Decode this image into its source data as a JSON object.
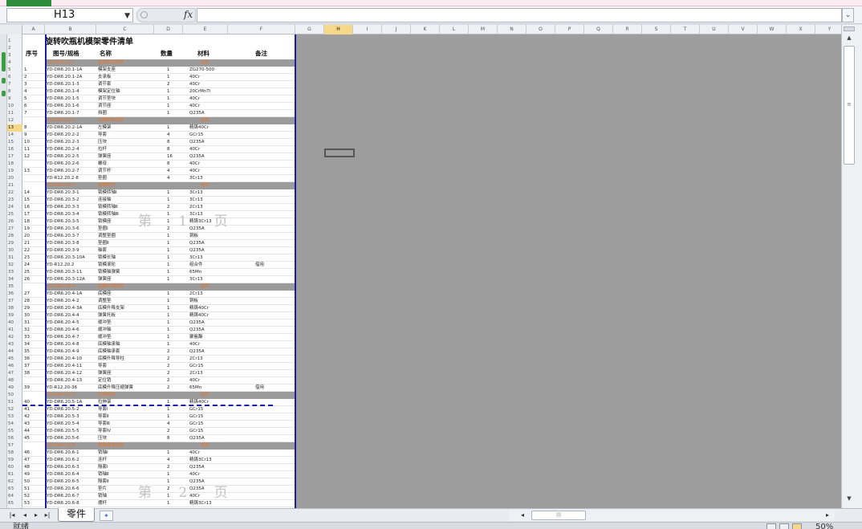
{
  "app": {
    "file_tab_color": "#2e8b3a"
  },
  "formula_bar": {
    "name_box": "H13",
    "fx_label": "fx",
    "formula": ""
  },
  "columns": [
    {
      "label": "A",
      "w": 28
    },
    {
      "label": "B",
      "w": 64
    },
    {
      "label": "C",
      "w": 72
    },
    {
      "label": "D",
      "w": 36
    },
    {
      "label": "E",
      "w": 56
    },
    {
      "label": "F",
      "w": 84
    },
    {
      "label": "G"
    },
    {
      "label": "H",
      "selected": true
    },
    {
      "label": "I"
    },
    {
      "label": "J"
    },
    {
      "label": "K"
    },
    {
      "label": "L"
    },
    {
      "label": "M"
    },
    {
      "label": "N"
    },
    {
      "label": "O"
    },
    {
      "label": "P"
    },
    {
      "label": "Q"
    },
    {
      "label": "R"
    },
    {
      "label": "S"
    },
    {
      "label": "T"
    },
    {
      "label": "U"
    },
    {
      "label": "V"
    },
    {
      "label": "W"
    },
    {
      "label": "X"
    },
    {
      "label": "Y"
    }
  ],
  "sheet": {
    "title": "旋转吹瓶机模架零件清单",
    "header": {
      "seq": "序号",
      "code": "图号/规格",
      "name": "名称",
      "qty": "数量",
      "mat": "材料",
      "note": "备注"
    },
    "group_rows": [
      {
        "row": 4,
        "code": "YD-DR6.20.1",
        "name": "模架支架组件",
        "mat": "组件"
      },
      {
        "row": 12,
        "code": "YD-DR6.20.2",
        "name": "合模机构组件",
        "mat": "组件"
      },
      {
        "row": 21,
        "code": "YD-DR6.20.3",
        "name": "锁模组件",
        "mat": "组件"
      },
      {
        "row": 35,
        "code": "YD-DR6.20.4",
        "name": "底模升降组件",
        "mat": "组件"
      },
      {
        "row": 50,
        "code": "YD-DR6.20.5",
        "name": "拉伸组件",
        "mat": "组件"
      },
      {
        "row": 57,
        "code": "YD-DR6.20.6",
        "name": "模具锁紧组件",
        "mat": "组件"
      }
    ],
    "rows": [
      {
        "r": 5,
        "seq": "1",
        "code": "YD-DR6.20.1-1A",
        "name": "模架支座",
        "qty": "1",
        "mat": "ZG270-500",
        "note": ""
      },
      {
        "r": 6,
        "seq": "2",
        "code": "YD-DR6.20.1-2A",
        "name": "支承板",
        "qty": "1",
        "mat": "40Cr",
        "note": ""
      },
      {
        "r": 7,
        "seq": "3",
        "code": "YD-DR6.20.1-3",
        "name": "调节套",
        "qty": "2",
        "mat": "40Cr",
        "note": ""
      },
      {
        "r": 8,
        "seq": "4",
        "code": "YD-DR6.20.1-4",
        "name": "模架定位轴",
        "qty": "1",
        "mat": "20CrMnTi",
        "note": ""
      },
      {
        "r": 9,
        "seq": "5",
        "code": "YD-DR6.20.1-5",
        "name": "调节垫块",
        "qty": "1",
        "mat": "40Cr",
        "note": ""
      },
      {
        "r": 10,
        "seq": "6",
        "code": "YD-DR6.20.1-6",
        "name": "调节座",
        "qty": "1",
        "mat": "40Cr",
        "note": ""
      },
      {
        "r": 11,
        "seq": "7",
        "code": "YD-DR6.20.1-7",
        "name": "挡圈",
        "qty": "1",
        "mat": "Q235A",
        "note": ""
      },
      {
        "r": 13,
        "seq": "8",
        "code": "YD-DR6.20.2-1A",
        "name": "左模架",
        "qty": "1",
        "mat": "精铸40Cr",
        "note": ""
      },
      {
        "r": 14,
        "seq": "9",
        "code": "YD-DR6.20.2-2",
        "name": "导套",
        "qty": "4",
        "mat": "GCr15",
        "note": ""
      },
      {
        "r": 15,
        "seq": "10",
        "code": "YD-DR6.20.2-3",
        "name": "压块",
        "qty": "8",
        "mat": "Q235A",
        "note": ""
      },
      {
        "r": 16,
        "seq": "11",
        "code": "YD-DR6.20.2-4",
        "name": "拉杆",
        "qty": "8",
        "mat": "40Cr",
        "note": ""
      },
      {
        "r": 17,
        "seq": "12",
        "code": "YD-DR6.20.2-5",
        "name": "弹簧座",
        "qty": "16",
        "mat": "Q235A",
        "note": ""
      },
      {
        "r": 18,
        "seq": "",
        "code": "YD-DR6.20.2-6",
        "name": "螺母",
        "qty": "8",
        "mat": "40Cr",
        "note": ""
      },
      {
        "r": 19,
        "seq": "13",
        "code": "YD-DR6.20.2-7",
        "name": "调节杆",
        "qty": "4",
        "mat": "40Cr",
        "note": ""
      },
      {
        "r": 20,
        "seq": "",
        "code": "YD-R12.20.2-8",
        "name": "垫圈",
        "qty": "4",
        "mat": "3Cr13",
        "note": ""
      },
      {
        "r": 22,
        "seq": "14",
        "code": "YD-DR6.20.3-1",
        "name": "锁模转轴Ⅰ",
        "qty": "1",
        "mat": "3Cr13",
        "note": ""
      },
      {
        "r": 23,
        "seq": "15",
        "code": "YD-DR6.20.3-2",
        "name": "连接轴",
        "qty": "1",
        "mat": "3Cr13",
        "note": ""
      },
      {
        "r": 24,
        "seq": "16",
        "code": "YD-DR6.20.3-3",
        "name": "锁模转轴Ⅱ",
        "qty": "2",
        "mat": "2Cr13",
        "note": ""
      },
      {
        "r": 25,
        "seq": "17",
        "code": "YD-DR6.20.3-4",
        "name": "锁模转轴Ⅲ",
        "qty": "1",
        "mat": "3Cr13",
        "note": ""
      },
      {
        "r": 26,
        "seq": "18",
        "code": "YD-DR6.20.3-5",
        "name": "锁模座",
        "qty": "1",
        "mat": "精铸3Cr13",
        "note": ""
      },
      {
        "r": 27,
        "seq": "19",
        "code": "YD-DR6.20.3-6",
        "name": "垫圈Ⅰ",
        "qty": "2",
        "mat": "Q235A",
        "note": ""
      },
      {
        "r": 28,
        "seq": "20",
        "code": "YD-DR6.20.3-7",
        "name": "调整垫圈",
        "qty": "1",
        "mat": "铜板",
        "note": ""
      },
      {
        "r": 29,
        "seq": "21",
        "code": "YD-DR6.20.3-8",
        "name": "垫圈Ⅱ",
        "qty": "1",
        "mat": "Q235A",
        "note": ""
      },
      {
        "r": 30,
        "seq": "22",
        "code": "YD-DR6.20.3-9",
        "name": "轴套",
        "qty": "1",
        "mat": "Q235A",
        "note": ""
      },
      {
        "r": 31,
        "seq": "23",
        "code": "YD-DR6.20.3-10A",
        "name": "锁模长轴",
        "qty": "1",
        "mat": "3Cr13",
        "note": ""
      },
      {
        "r": 32,
        "seq": "24",
        "code": "YD-R12.20.2",
        "name": "锁模滚轮",
        "qty": "1",
        "mat": "组合件",
        "note": "借用"
      },
      {
        "r": 33,
        "seq": "25",
        "code": "YD-DR6.20.3-11",
        "name": "锁模轴弹簧",
        "qty": "1",
        "mat": "65Mn",
        "note": ""
      },
      {
        "r": 34,
        "seq": "26",
        "code": "YD-DR6.20.3-12A",
        "name": "弹簧座",
        "qty": "1",
        "mat": "3Cr13",
        "note": ""
      },
      {
        "r": 36,
        "seq": "27",
        "code": "YD-DR6.20.4-1A",
        "name": "底模座",
        "qty": "1",
        "mat": "2Cr13",
        "note": ""
      },
      {
        "r": 37,
        "seq": "28",
        "code": "YD-DR6.20.4-2",
        "name": "调整垫",
        "qty": "1",
        "mat": "铜板",
        "note": ""
      },
      {
        "r": 38,
        "seq": "29",
        "code": "YD-DR6.20.4-3A",
        "name": "底模升降支架",
        "qty": "1",
        "mat": "精铸40Cr",
        "note": ""
      },
      {
        "r": 39,
        "seq": "30",
        "code": "YD-DR6.20.4-4",
        "name": "弹簧托板",
        "qty": "1",
        "mat": "精铸40Cr",
        "note": ""
      },
      {
        "r": 40,
        "seq": "31",
        "code": "YD-DR6.20.4-5",
        "name": "缓冲垫",
        "qty": "1",
        "mat": "Q235A",
        "note": ""
      },
      {
        "r": 41,
        "seq": "32",
        "code": "YD-DR6.20.4-6",
        "name": "缓冲轴",
        "qty": "1",
        "mat": "Q235A",
        "note": ""
      },
      {
        "r": 42,
        "seq": "33",
        "code": "YD-DR6.20.4-7",
        "name": "缓冲垫",
        "qty": "1",
        "mat": "聚氨酯",
        "note": ""
      },
      {
        "r": 43,
        "seq": "34",
        "code": "YD-DR6.20.4-8",
        "name": "底模轴承轴",
        "qty": "1",
        "mat": "40Cr",
        "note": ""
      },
      {
        "r": 44,
        "seq": "35",
        "code": "YD-DR6.20.4-9",
        "name": "底模轴承套",
        "qty": "2",
        "mat": "Q235A",
        "note": ""
      },
      {
        "r": 45,
        "seq": "36",
        "code": "YD-DR6.20.4-10",
        "name": "底模升降导柱",
        "qty": "2",
        "mat": "2Cr13",
        "note": ""
      },
      {
        "r": 46,
        "seq": "37",
        "code": "YD-DR6.20.4-11",
        "name": "导套",
        "qty": "2",
        "mat": "GCr15",
        "note": ""
      },
      {
        "r": 47,
        "seq": "38",
        "code": "YD-DR6.20.4-12",
        "name": "弹簧座",
        "qty": "2",
        "mat": "2Cr13",
        "note": ""
      },
      {
        "r": 48,
        "seq": "",
        "code": "YD-DR6.20.4-13",
        "name": "定位销",
        "qty": "2",
        "mat": "40Cr",
        "note": ""
      },
      {
        "r": 49,
        "seq": "39",
        "code": "YD-R12.20-36",
        "name": "底模升降压缩弹簧",
        "qty": "2",
        "mat": "65Mn",
        "note": "借用"
      },
      {
        "r": 51,
        "seq": "40",
        "code": "YD-DR6.20.5-1A",
        "name": "拉伸架",
        "qty": "1",
        "mat": "精铸40Cr",
        "note": ""
      },
      {
        "r": 52,
        "seq": "41",
        "code": "YD-DR6.20.5-2",
        "name": "导套Ⅰ",
        "qty": "1",
        "mat": "GCr15",
        "note": ""
      },
      {
        "r": 53,
        "seq": "42",
        "code": "YD-DR6.20.5-3",
        "name": "导套Ⅱ",
        "qty": "1",
        "mat": "GCr15",
        "note": ""
      },
      {
        "r": 54,
        "seq": "43",
        "code": "YD-DR6.20.5-4",
        "name": "导套Ⅲ",
        "qty": "4",
        "mat": "GCr15",
        "note": ""
      },
      {
        "r": 55,
        "seq": "44",
        "code": "YD-DR6.20.5-5",
        "name": "导套Ⅳ",
        "qty": "2",
        "mat": "GCr15",
        "note": ""
      },
      {
        "r": 56,
        "seq": "45",
        "code": "YD-DR6.20.5-6",
        "name": "压块",
        "qty": "8",
        "mat": "Q235A",
        "note": ""
      },
      {
        "r": 58,
        "seq": "46",
        "code": "YD-DR6.20.6-1",
        "name": "销轴Ⅰ",
        "qty": "1",
        "mat": "40Cr",
        "note": ""
      },
      {
        "r": 59,
        "seq": "47",
        "code": "YD-DR6.20.6-2",
        "name": "连杆",
        "qty": "4",
        "mat": "精铸3Cr13",
        "note": ""
      },
      {
        "r": 60,
        "seq": "48",
        "code": "YD-DR6.20.6-3",
        "name": "隔套Ⅰ",
        "qty": "2",
        "mat": "Q235A",
        "note": ""
      },
      {
        "r": 61,
        "seq": "49",
        "code": "YD-DR6.20.6-4",
        "name": "销轴Ⅱ",
        "qty": "1",
        "mat": "40Cr",
        "note": ""
      },
      {
        "r": 62,
        "seq": "50",
        "code": "YD-DR6.20.6-5",
        "name": "隔套Ⅱ",
        "qty": "1",
        "mat": "Q235A",
        "note": ""
      },
      {
        "r": 63,
        "seq": "51",
        "code": "YD-DR6.20.6-6",
        "name": "垫片",
        "qty": "2",
        "mat": "Q235A",
        "note": ""
      },
      {
        "r": 64,
        "seq": "52",
        "code": "YD-DR6.20.6-7",
        "name": "销轴",
        "qty": "1",
        "mat": "40Cr",
        "note": ""
      },
      {
        "r": 65,
        "seq": "53",
        "code": "YD-DR6.20.6-8",
        "name": "摆杆",
        "qty": "1",
        "mat": "精铸3Cr13",
        "note": ""
      }
    ],
    "page_marks": [
      "第 1 页",
      "第 2 页"
    ]
  },
  "tabs": {
    "sheet_name": "零件"
  },
  "status": {
    "text": "就绪",
    "zoom": "50%"
  },
  "colors": {
    "group_bg": "#9b9b9b",
    "group_text": "#e8742a",
    "page_border": "#1a1aa8",
    "selected_header": "#f6d88a"
  }
}
